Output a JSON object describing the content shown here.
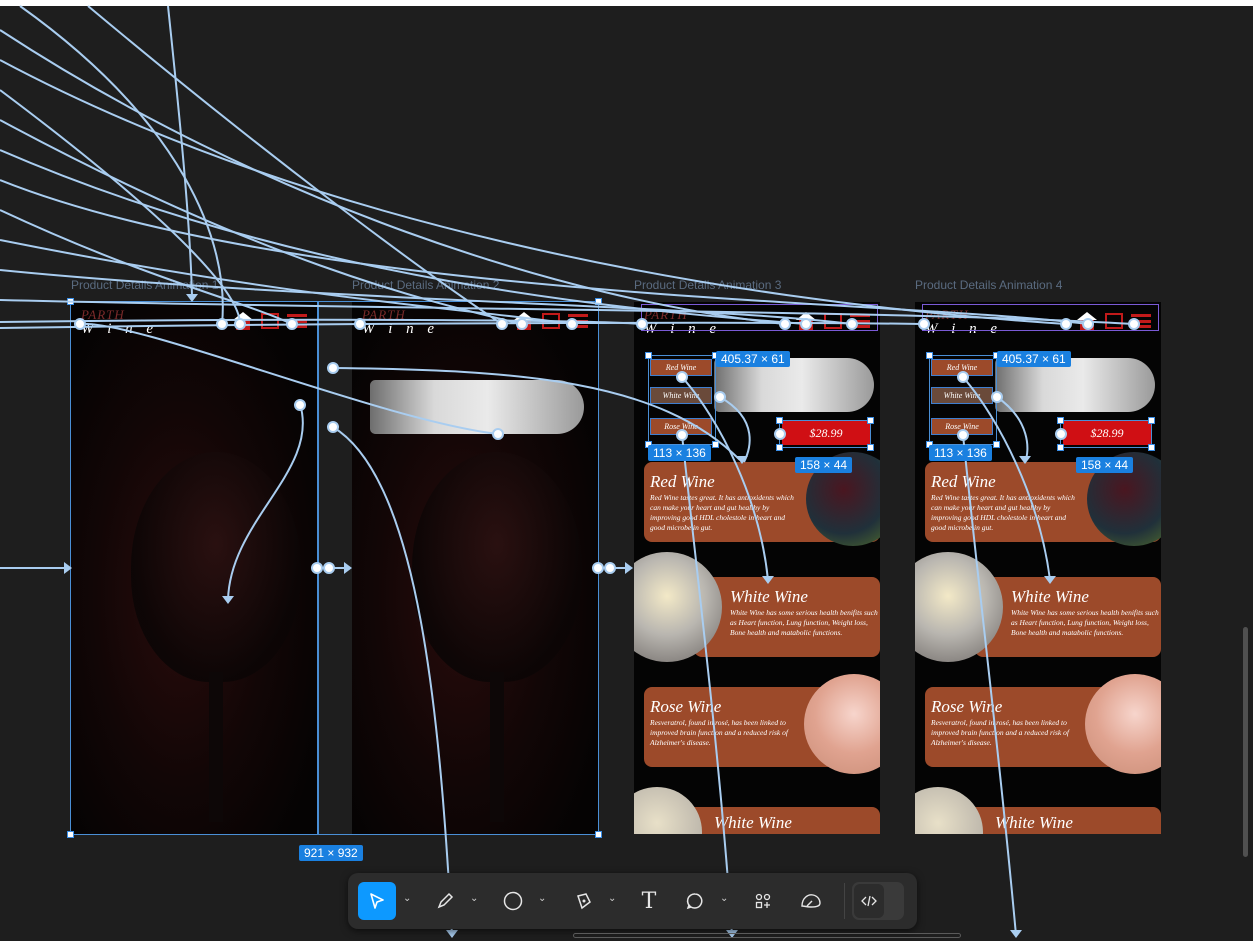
{
  "frames": [
    {
      "label": "Product Details Animation 1"
    },
    {
      "label": "Product Details Animation 2"
    },
    {
      "label": "Product Details Animation 3"
    },
    {
      "label": "Product Details Animation 4"
    }
  ],
  "logo": {
    "line1": "PARTH",
    "line2": "W i n e"
  },
  "pills": {
    "red": "Red Wine",
    "white": "White Wine",
    "rose": "Rose Wine"
  },
  "price": "$28.99",
  "cards": {
    "red": {
      "title": "Red Wine",
      "text": "Red Wine tastes great. It has antioxidents which can make your heart and gut healthy by improving good HDL cholestole in heart and good microbe in gut."
    },
    "white": {
      "title": "White Wine",
      "text": "White Wine has some serious health benifits such as Heart function, Lung function, Weight loss, Bone health and matabolic functions."
    },
    "rose": {
      "title": "Rose Wine",
      "text": "Resveratrol, found in rosé, has been linked to improved brain function and a reduced risk of Alzheimer's disease."
    },
    "white2": {
      "title": "White Wine"
    }
  },
  "dimensions": {
    "selection": "921 × 932",
    "nav_bar": "405.37 × 61",
    "pill_group": "113 × 136",
    "price_button": "158 × 44"
  },
  "toolbar": {
    "tools": [
      "move-tool",
      "pen-tool",
      "ellipse-tool",
      "pencil-tool",
      "text-tool",
      "comment-tool",
      "components-tool",
      "plugins-tool",
      "dev-mode-toggle"
    ],
    "active_tool": "move-tool"
  },
  "colors": {
    "canvas_bg": "#1e1e1e",
    "connector": "#a9cdf0",
    "selection": "#1a80e0",
    "wine_card": "#9c4a2a",
    "price_red": "#d00f14"
  }
}
